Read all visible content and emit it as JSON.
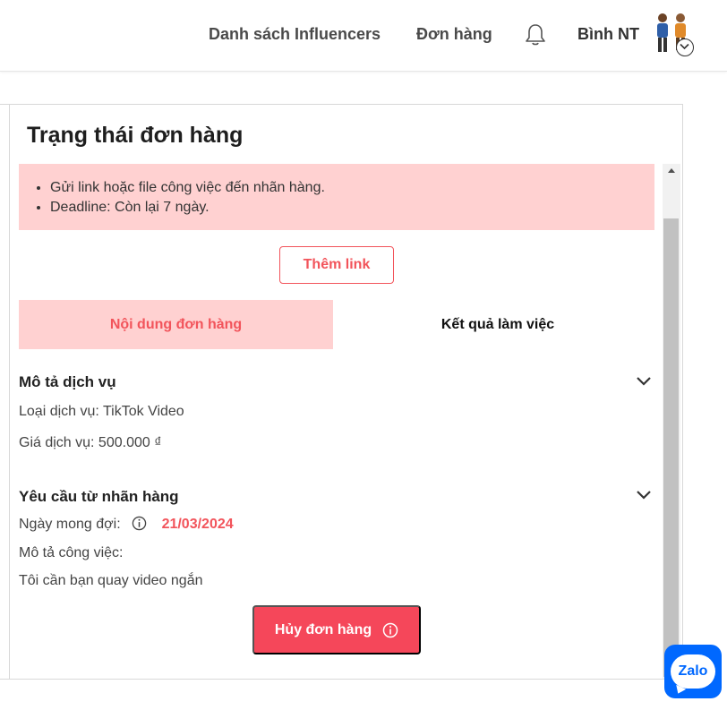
{
  "header": {
    "nav": [
      {
        "label": "Danh sách Influencers"
      },
      {
        "label": "Đơn hàng"
      }
    ],
    "notification_icon": "bell-icon",
    "user_name": "Bình NT",
    "avatar_icon": "avatar-people-icon"
  },
  "panel": {
    "title": "Trạng thái đơn hàng",
    "notice_items": [
      "Gửi link hoặc file công việc đến nhãn hàng.",
      "Deadline: Còn lại 7 ngày."
    ],
    "add_link_label": "Thêm link",
    "tabs": [
      {
        "label": "Nội dung đơn hàng",
        "active": true
      },
      {
        "label": "Kết quả làm việc",
        "active": false
      }
    ],
    "service": {
      "title": "Mô tả dịch vụ",
      "type": "Loại dịch vụ: TikTok Video",
      "price": "Giá dịch vụ: 500.000 ₫"
    },
    "request": {
      "title": "Yêu cầu từ nhãn hàng",
      "expected_date_label": "Ngày mong đợi:",
      "expected_date": "21/03/2024",
      "job_desc_label": "Mô tả công việc:",
      "job_desc": "Tôi cần bạn quay video ngắn"
    },
    "cancel_label": "Hủy đơn hàng"
  },
  "widget": {
    "zalo_label": "Zalo"
  },
  "colors": {
    "accent": "#f2545b",
    "notice_bg": "#ffd1d1",
    "cancel_bg": "#f5475a",
    "zalo_blue": "#0068ff"
  }
}
